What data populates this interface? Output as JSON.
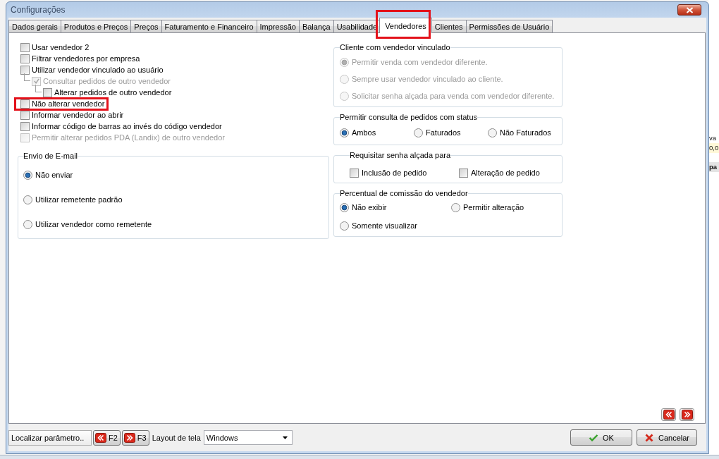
{
  "window": {
    "title": "Configurações"
  },
  "tabs": [
    {
      "label": "Dados gerais",
      "selected": false,
      "highlighted": false
    },
    {
      "label": "Produtos e Preços",
      "selected": false,
      "highlighted": false
    },
    {
      "label": "Preços",
      "selected": false,
      "highlighted": false
    },
    {
      "label": "Faturamento e Financeiro",
      "selected": false,
      "highlighted": false
    },
    {
      "label": "Impressão",
      "selected": false,
      "highlighted": false
    },
    {
      "label": "Balança",
      "selected": false,
      "highlighted": false
    },
    {
      "label": "Usabilidade",
      "selected": false,
      "highlighted": false
    },
    {
      "label": "Vendedores",
      "selected": true,
      "highlighted": true
    },
    {
      "label": "Clientes",
      "selected": false,
      "highlighted": false
    },
    {
      "label": "Permissões de Usuário",
      "selected": false,
      "highlighted": false
    }
  ],
  "options": [
    {
      "label": "Usar vendedor 2",
      "checked": false,
      "disabled": false,
      "highlighted": false
    },
    {
      "label": "Filtrar vendedores por empresa",
      "checked": false,
      "disabled": false,
      "highlighted": false
    },
    {
      "label": "Utilizar vendedor vinculado ao usuário",
      "checked": false,
      "disabled": false,
      "highlighted": false,
      "children": [
        {
          "label": "Consultar pedidos de outro vendedor",
          "checked": true,
          "disabled": true,
          "highlighted": false,
          "children": [
            {
              "label": "Alterar pedidos de outro vendedor",
              "checked": false,
              "disabled": false,
              "highlighted": false
            }
          ]
        }
      ]
    },
    {
      "label": "Não alterar vendedor",
      "checked": false,
      "disabled": false,
      "highlighted": true
    },
    {
      "label": "Informar vendedor ao abrir",
      "checked": false,
      "disabled": false,
      "highlighted": false
    },
    {
      "label": "Informar código de barras ao invés do código vendedor",
      "checked": false,
      "disabled": false,
      "highlighted": false
    },
    {
      "label": "Permitir alterar pedidos PDA (Landix) de outro vendedor",
      "checked": false,
      "disabled": true,
      "highlighted": false
    }
  ],
  "left_groups": [
    {
      "title": "Envio de E-mail",
      "kind": "radio",
      "disabled": false,
      "items": [
        {
          "label": "Não enviar",
          "selected": true
        },
        {
          "label": "Utilizar remetente padrão",
          "selected": false
        },
        {
          "label": "Utilizar vendedor como remetente",
          "selected": false
        }
      ]
    }
  ],
  "right_groups": [
    {
      "title": "Cliente com vendedor vinculado",
      "kind": "radio",
      "disabled": true,
      "items": [
        {
          "label": "Permitir venda com vendedor diferente.",
          "selected": true
        },
        {
          "label": "Sempre usar vendedor vinculado ao cliente.",
          "selected": false
        },
        {
          "label": "Solicitar senha alçada para venda com vendedor diferente.",
          "selected": false
        }
      ]
    },
    {
      "title": "Permitir consulta de pedidos com status",
      "kind": "radio",
      "disabled": false,
      "items": [
        {
          "label": "Ambos",
          "selected": true
        },
        {
          "label": "Faturados",
          "selected": false
        },
        {
          "label": "Não Faturados",
          "selected": false
        }
      ]
    },
    {
      "title": "Requisitar senha alçada para",
      "kind": "checkbox",
      "disabled": false,
      "items": [
        {
          "label": "Inclusão de pedido",
          "checked": false
        },
        {
          "label": "Alteração de pedido",
          "checked": false
        }
      ]
    },
    {
      "title": "Percentual de comissão do vendedor",
      "kind": "radio",
      "disabled": false,
      "items": [
        {
          "label": "Não exibir",
          "selected": true
        },
        {
          "label": "Permitir alteração",
          "selected": false
        },
        {
          "label": "Somente visualizar",
          "selected": false
        }
      ]
    }
  ],
  "footer": {
    "search": {
      "placeholder": "Localizar parâmetro.."
    },
    "shortcuts": [
      {
        "label": "F2",
        "kind": "prev"
      },
      {
        "label": "F3",
        "kind": "next"
      }
    ],
    "layout_select": {
      "label": "Layout de tela",
      "value": "Windows"
    },
    "buttons": [
      {
        "label": "OK",
        "kind": "ok"
      },
      {
        "label": "Cancelar",
        "kind": "cancel"
      }
    ]
  },
  "background": {
    "fragments": [
      "va",
      "0,0",
      "pa"
    ]
  }
}
